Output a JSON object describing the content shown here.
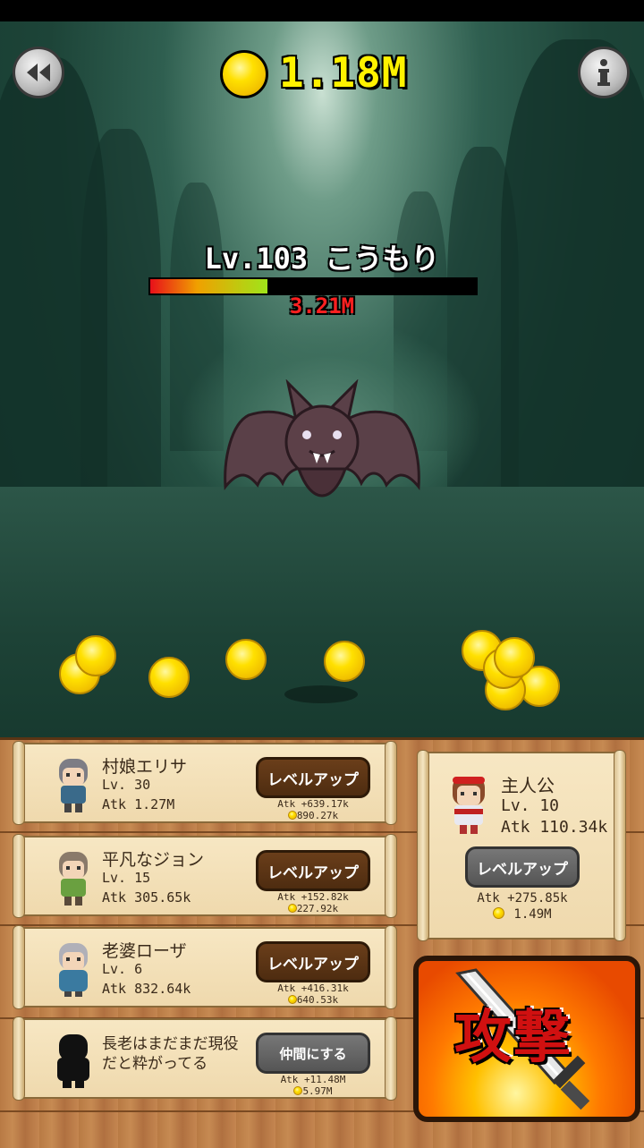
{
  "hud": {
    "gold": "1.18M",
    "back_icon": "rewind-icon",
    "info_icon": "info-icon"
  },
  "enemy": {
    "name_line": "Lv.103 こうもり",
    "hp_text": "3.21M",
    "hp_fraction": 0.36,
    "sprite": "bat-sprite"
  },
  "allies": [
    {
      "name": "村娘エリサ",
      "level": "Lv. 30",
      "atk": "Atk 1.27M",
      "button": "レベルアップ",
      "atk_gain": "Atk +639.17k",
      "cost": "890.27k",
      "hair": "#7d7d85",
      "shirt": "#3a6a8a"
    },
    {
      "name": "平凡なジョン",
      "level": "Lv. 15",
      "atk": "Atk 305.65k",
      "button": "レベルアップ",
      "atk_gain": "Atk +152.82k",
      "cost": "227.92k",
      "hair": "#8a7a6a",
      "shirt": "#6aa040"
    },
    {
      "name": "老婆ローザ",
      "level": "Lv. 6",
      "atk": "Atk 832.64k",
      "button": "レベルアップ",
      "atk_gain": "Atk +416.31k",
      "cost": "640.53k",
      "hair": "#b0b0b8",
      "shirt": "#3a7aa0"
    },
    {
      "name_line1": "長老はまだまだ現役",
      "name_line2": "だと粋がってる",
      "button": "仲間にする",
      "atk_gain": "Atk +11.48M",
      "cost": "5.97M"
    }
  ],
  "hero": {
    "name": "主人公",
    "level": "Lv. 10",
    "atk": "Atk 110.34k",
    "button": "レベルアップ",
    "atk_gain": "Atk +275.85k",
    "cost": "1.49M"
  },
  "attack_button": {
    "label": "攻撃",
    "icon": "sword-icon"
  }
}
